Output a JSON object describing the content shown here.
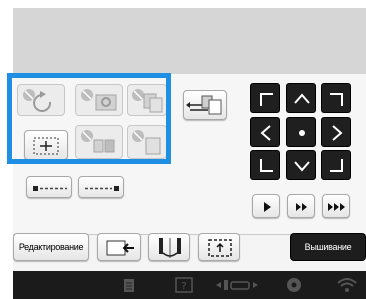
{
  "screen": {
    "buttons": {
      "edit_label": "Редактирование",
      "sew_label": "Вышивание"
    },
    "icons": {
      "rotate": "rotate-icon",
      "pattern_settings": "pattern-settings-icon",
      "copy": "copy-icon",
      "align": "align-icon",
      "center": "center-icon",
      "group": "group-icon",
      "arrange": "arrange-icon",
      "line_left": "line-left-icon",
      "line_right": "line-right-icon",
      "move_up_left": "arrow-up-left-icon",
      "move_up": "arrow-up-icon",
      "move_up_right": "arrow-up-right-icon",
      "move_left": "arrow-left-icon",
      "move_center": "center-dot-icon",
      "move_right": "arrow-right-icon",
      "move_down_left": "arrow-down-left-icon",
      "move_down": "arrow-down-icon",
      "move_down_right": "arrow-down-right-icon",
      "play": "play-icon",
      "fast_forward": "fast-forward-icon",
      "skip": "skip-forward-icon",
      "edit_insert": "insert-icon",
      "needle": "needle-icon",
      "trial": "trial-frame-icon"
    },
    "footer_icons": [
      "page-icon",
      "help-icon",
      "frame-move-icon",
      "settings-icon",
      "wifi-icon"
    ],
    "colors": {
      "highlight": "#1f8fe4",
      "dark_button": "#1f1f1f",
      "footer": "#1b1b1b"
    }
  }
}
